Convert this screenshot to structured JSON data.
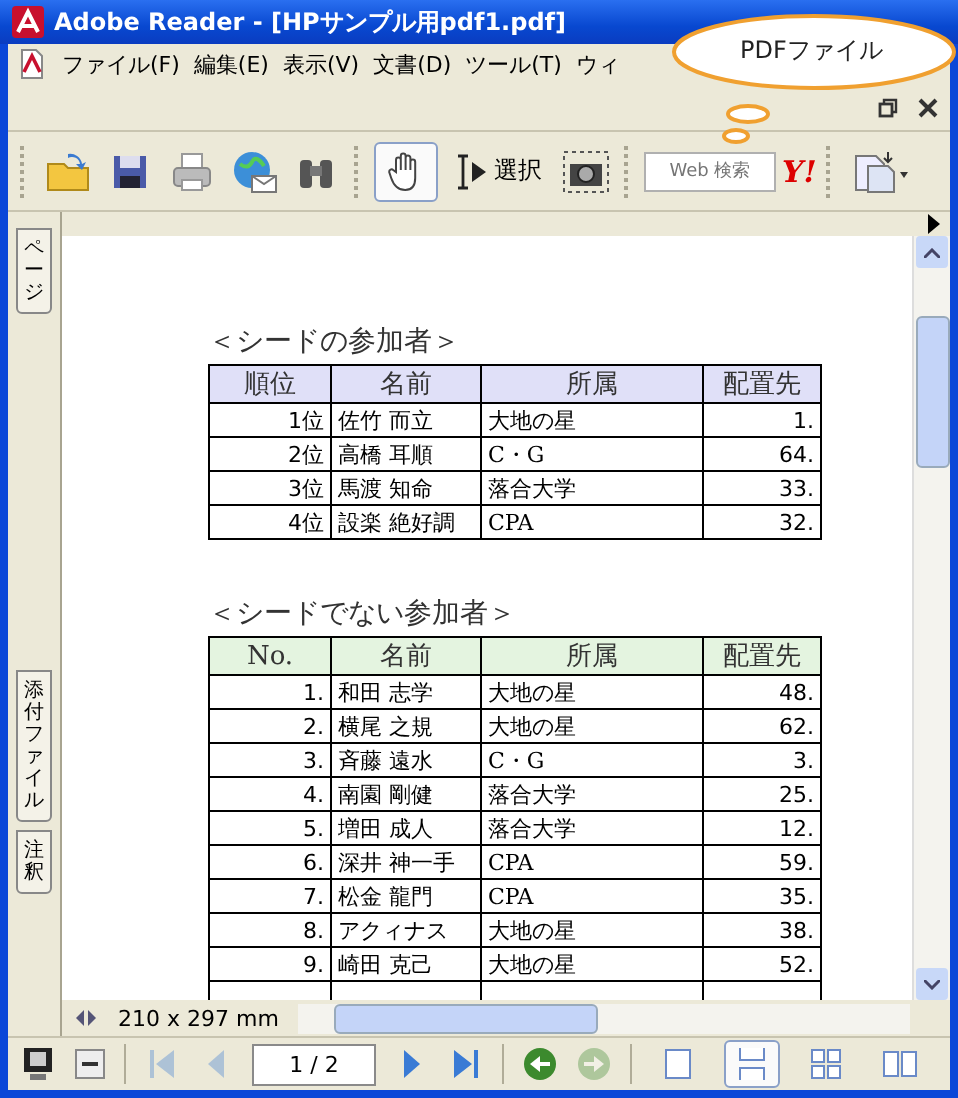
{
  "window": {
    "title": "Adobe Reader - [HPサンプル用pdf1.pdf]"
  },
  "menu": [
    "ファイル(F)",
    "編集(E)",
    "表示(V)",
    "文書(D)",
    "ツール(T)",
    "ウィ"
  ],
  "callout": {
    "text": "PDFファイル"
  },
  "toolbar": {
    "tools": [
      {
        "kind": "hand",
        "selected": true
      },
      {
        "kind": "select",
        "label": "選択",
        "selected": false
      }
    ],
    "search": {
      "placeholder": "Web 検索"
    },
    "search_logo": "Y!"
  },
  "side_tabs": [
    {
      "label": "ページ"
    },
    {
      "label": "添付ファイル"
    },
    {
      "label": "注釈"
    }
  ],
  "document": {
    "sections": [
      {
        "title": "＜シードの参加者＞",
        "kind": "seeded",
        "columns": [
          "順位",
          "名前",
          "所属",
          "配置先"
        ],
        "rows": [
          [
            "1位",
            "佐竹 而立",
            "大地の星",
            "1."
          ],
          [
            "2位",
            "高橋 耳順",
            "C・G",
            "64."
          ],
          [
            "3位",
            "馬渡 知命",
            "落合大学",
            "33."
          ],
          [
            "4位",
            "設楽 絶好調",
            "CPA",
            "32."
          ]
        ]
      },
      {
        "title": "＜シードでない参加者＞",
        "kind": "unseeded",
        "columns": [
          "No.",
          "名前",
          "所属",
          "配置先"
        ],
        "rows": [
          [
            "1.",
            "和田 志学",
            "大地の星",
            "48."
          ],
          [
            "2.",
            "横尾 之規",
            "大地の星",
            "62."
          ],
          [
            "3.",
            "斉藤 遠水",
            "C・G",
            "3."
          ],
          [
            "4.",
            "南園 剛健",
            "落合大学",
            "25."
          ],
          [
            "5.",
            "増田 成人",
            "落合大学",
            "12."
          ],
          [
            "6.",
            "深井 神一手",
            "CPA",
            "59."
          ],
          [
            "7.",
            "松金 龍門",
            "CPA",
            "35."
          ],
          [
            "8.",
            "アクィナス",
            "大地の星",
            "38."
          ],
          [
            "9.",
            "崎田 克己",
            "大地の星",
            "52."
          ]
        ]
      }
    ]
  },
  "status": {
    "page_size": "210 x 297 mm"
  },
  "nav": {
    "buttons": [
      {
        "kind": "first",
        "disabled": true
      },
      {
        "kind": "prev",
        "disabled": true
      }
    ],
    "page_field": "1 / 2",
    "after": [
      {
        "kind": "next",
        "disabled": false
      },
      {
        "kind": "last",
        "disabled": false
      },
      {
        "kind": "back",
        "disabled": false
      },
      {
        "kind": "forward",
        "disabled": true
      }
    ],
    "layouts": [
      {
        "kind": "single",
        "selected": false
      },
      {
        "kind": "continuous",
        "selected": true
      },
      {
        "kind": "grid",
        "selected": false
      },
      {
        "kind": "facing",
        "selected": false
      }
    ]
  }
}
